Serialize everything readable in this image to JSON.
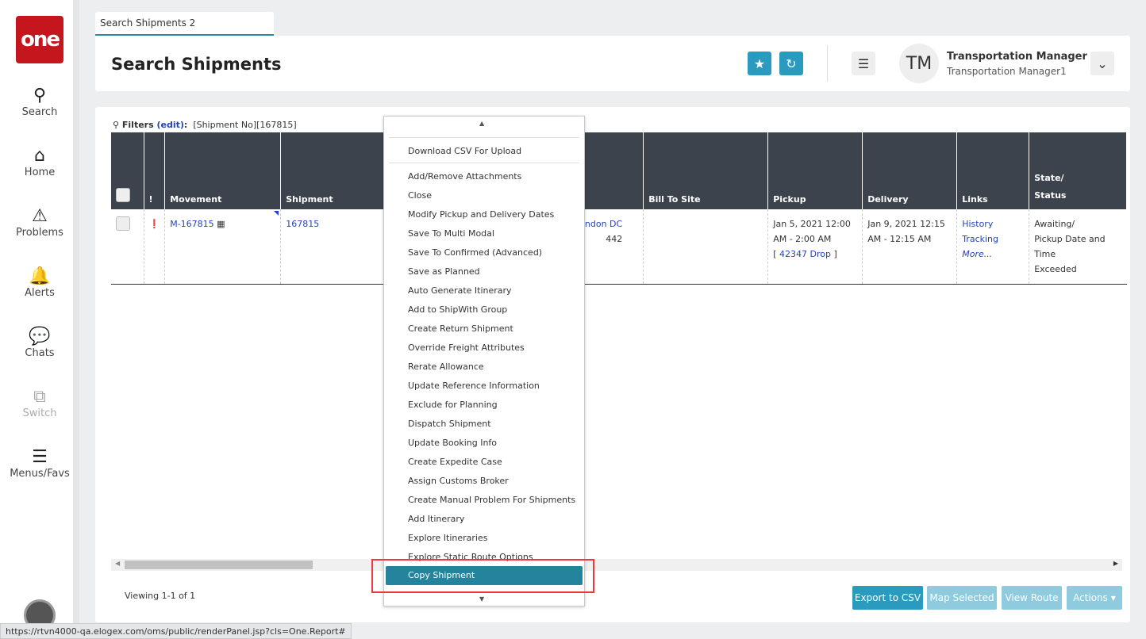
{
  "sidebar": {
    "logo": "one",
    "items": [
      {
        "label": "Search",
        "icon": "search-icon"
      },
      {
        "label": "Home",
        "icon": "home-icon"
      },
      {
        "label": "Problems",
        "icon": "warning-icon"
      },
      {
        "label": "Alerts",
        "icon": "bell-icon"
      },
      {
        "label": "Chats",
        "icon": "chat-icon"
      },
      {
        "label": "Switch",
        "icon": "switch-icon"
      },
      {
        "label": "Menus/Favs",
        "icon": "menu-icon"
      }
    ]
  },
  "tab": {
    "label": "Search Shipments 2"
  },
  "header": {
    "title": "Search Shipments",
    "user_initials": "TM",
    "user_name": "Transportation Manager",
    "user_role": "Transportation Manager1"
  },
  "filters": {
    "label": "Filters",
    "edit": "(edit)",
    "colon": ":",
    "value": "[Shipment No][167815]"
  },
  "table": {
    "columns": [
      "!",
      "Movement",
      "Shipment",
      "",
      "Bill To Site",
      "Pickup",
      "Delivery",
      "Links",
      "State/",
      "Status"
    ],
    "row": {
      "movement": "M-167815",
      "shipment": "167815",
      "site_line1": "ndon DC",
      "site_line2": "442",
      "bill_to": "",
      "pickup_line1": "Jan 5, 2021 12:00",
      "pickup_line2": "AM - 2:00 AM",
      "pickup_open": "[ ",
      "pickup_link": "42347 Drop",
      "pickup_close": " ]",
      "delivery_line1": "Jan 9, 2021 12:15",
      "delivery_line2": "AM - 12:15 AM",
      "links": [
        "History",
        "Tracking",
        "More..."
      ],
      "status_line1": "Awaiting/",
      "status_line2": "Pickup Date and Time",
      "status_line3": "Exceeded"
    }
  },
  "footer": {
    "viewing": "Viewing 1-1 of 1",
    "export": "Export to CSV",
    "map": "Map Selected",
    "route": "View Route",
    "actions": "Actions"
  },
  "menu": {
    "top_item": "Download CSV For Upload",
    "items": [
      "Add/Remove Attachments",
      "Close",
      "Modify Pickup and Delivery Dates",
      "Save To Multi Modal",
      "Save To Confirmed (Advanced)",
      "Save as Planned",
      "Auto Generate Itinerary",
      "Add to ShipWith Group",
      "Create Return Shipment",
      "Override Freight Attributes",
      "Rerate Allowance",
      "Update Reference Information",
      "Exclude for Planning",
      "Dispatch Shipment",
      "Update Booking Info",
      "Create Expedite Case",
      "Assign Customs Broker",
      "Create Manual Problem For Shipments",
      "Add Itinerary",
      "Explore Itineraries",
      "Explore Static Route Options"
    ],
    "highlighted": "Copy Shipment"
  },
  "statusbar": {
    "url": "https://rtvn4000-qa.elogex.com/oms/public/renderPanel.jsp?cls=One.Report#"
  }
}
